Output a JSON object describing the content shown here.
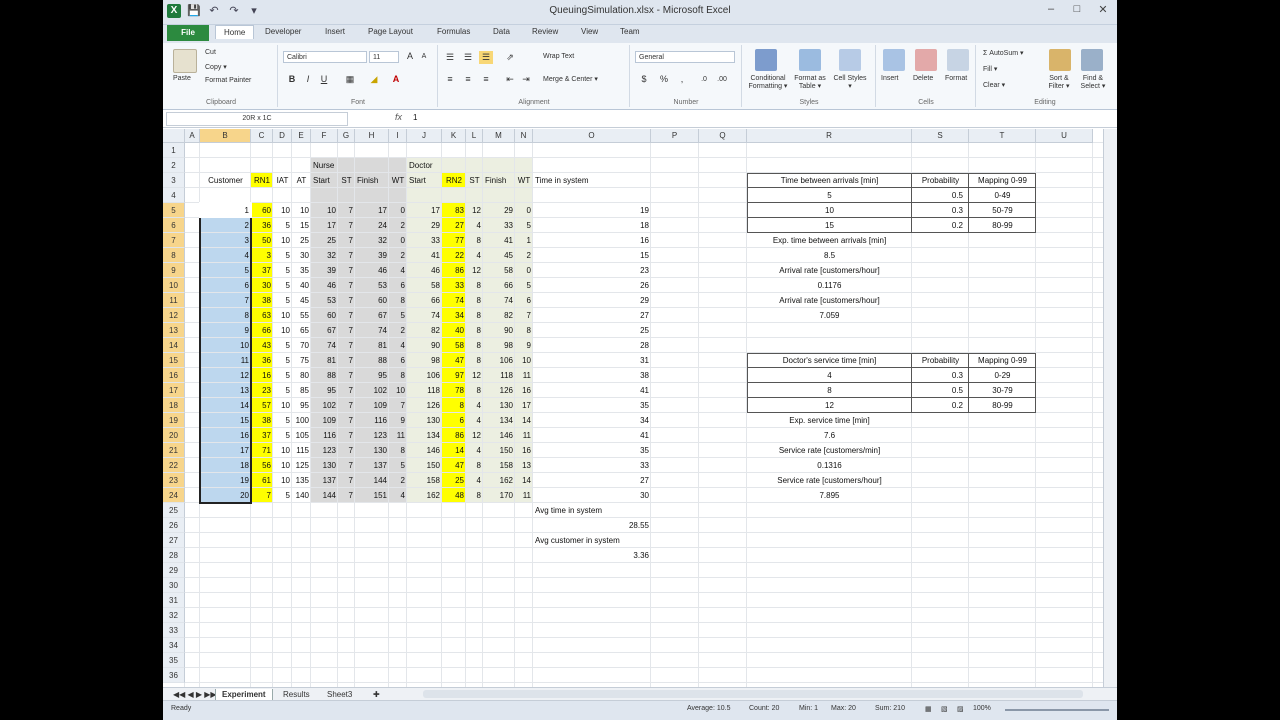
{
  "window": {
    "title": "QueuingSimulation.xlsx - Microsoft Excel",
    "controls": [
      "–",
      "□",
      "✕"
    ]
  },
  "qat": [
    "💾",
    "↶",
    "↷",
    "▾"
  ],
  "tabs": [
    "File",
    "Home",
    "Developer",
    "Insert",
    "Page Layout",
    "Formulas",
    "Data",
    "Review",
    "View",
    "Team"
  ],
  "ribbon": {
    "clipboard": {
      "label": "Clipboard",
      "paste": "Paste",
      "cut": "Cut",
      "copy": "Copy ▾",
      "format_painter": "Format Painter"
    },
    "font": {
      "label": "Font",
      "name": "Calibri",
      "size": "11",
      "bold": "B",
      "italic": "I",
      "underline": "U"
    },
    "alignment": {
      "label": "Alignment",
      "wrap": "Wrap Text",
      "merge": "Merge & Center ▾"
    },
    "number": {
      "label": "Number",
      "format": "General",
      "currency": "$",
      "percent": "%",
      "comma": ","
    },
    "styles": {
      "label": "Styles",
      "conditional": "Conditional Formatting ▾",
      "table": "Format as Table ▾",
      "cell": "Cell Styles ▾"
    },
    "cells": {
      "label": "Cells",
      "insert": "Insert",
      "delete": "Delete",
      "format": "Format"
    },
    "editing": {
      "label": "Editing",
      "autosum": "AutoSum ▾",
      "fill": "Fill ▾",
      "clear": "Clear ▾",
      "sort": "Sort & Filter ▾",
      "find": "Find & Select ▾"
    }
  },
  "formula_bar": {
    "name_box": "20R x 1C",
    "fx": "fx",
    "value": "1"
  },
  "columns": [
    "A",
    "B",
    "C",
    "D",
    "E",
    "F",
    "G",
    "H",
    "I",
    "J",
    "K",
    "L",
    "M",
    "N",
    "O",
    "P",
    "Q",
    "R",
    "S",
    "T",
    "U"
  ],
  "rows": [
    "1",
    "2",
    "3",
    "4",
    "5",
    "6",
    "7",
    "8",
    "9",
    "10",
    "11",
    "12",
    "13",
    "14",
    "15",
    "16",
    "17",
    "18",
    "19",
    "20",
    "21",
    "22",
    "23",
    "24",
    "25",
    "26",
    "27",
    "28",
    "29",
    "30",
    "31",
    "32",
    "33",
    "34",
    "35",
    "36"
  ],
  "headers": {
    "nurse": "Nurse",
    "doctor": "Doctor",
    "customer": "Customer",
    "rn1": "RN1",
    "iat": "IAT",
    "at": "AT",
    "start1": "Start",
    "st1": "ST",
    "finish1": "Finish",
    "wt1": "WT",
    "start2": "Start",
    "rn2": "RN2",
    "st2": "ST",
    "finish2": "Finish",
    "wt2": "WT",
    "tis": "Time in system"
  },
  "data_rows": [
    [
      "1",
      "60",
      "10",
      "10",
      "10",
      "7",
      "17",
      "0",
      "17",
      "83",
      "12",
      "29",
      "0",
      "19"
    ],
    [
      "2",
      "36",
      "5",
      "15",
      "17",
      "7",
      "24",
      "2",
      "29",
      "27",
      "4",
      "33",
      "5",
      "18"
    ],
    [
      "3",
      "50",
      "10",
      "25",
      "25",
      "7",
      "32",
      "0",
      "33",
      "77",
      "8",
      "41",
      "1",
      "16"
    ],
    [
      "4",
      "3",
      "5",
      "30",
      "32",
      "7",
      "39",
      "2",
      "41",
      "22",
      "4",
      "45",
      "2",
      "15"
    ],
    [
      "5",
      "37",
      "5",
      "35",
      "39",
      "7",
      "46",
      "4",
      "46",
      "86",
      "12",
      "58",
      "0",
      "23"
    ],
    [
      "6",
      "30",
      "5",
      "40",
      "46",
      "7",
      "53",
      "6",
      "58",
      "33",
      "8",
      "66",
      "5",
      "26"
    ],
    [
      "7",
      "38",
      "5",
      "45",
      "53",
      "7",
      "60",
      "8",
      "66",
      "74",
      "8",
      "74",
      "6",
      "29"
    ],
    [
      "8",
      "63",
      "10",
      "55",
      "60",
      "7",
      "67",
      "5",
      "74",
      "34",
      "8",
      "82",
      "7",
      "27"
    ],
    [
      "9",
      "66",
      "10",
      "65",
      "67",
      "7",
      "74",
      "2",
      "82",
      "40",
      "8",
      "90",
      "8",
      "25"
    ],
    [
      "10",
      "43",
      "5",
      "70",
      "74",
      "7",
      "81",
      "4",
      "90",
      "58",
      "8",
      "98",
      "9",
      "28"
    ],
    [
      "11",
      "36",
      "5",
      "75",
      "81",
      "7",
      "88",
      "6",
      "98",
      "47",
      "8",
      "106",
      "10",
      "31"
    ],
    [
      "12",
      "16",
      "5",
      "80",
      "88",
      "7",
      "95",
      "8",
      "106",
      "97",
      "12",
      "118",
      "11",
      "38"
    ],
    [
      "13",
      "23",
      "5",
      "85",
      "95",
      "7",
      "102",
      "10",
      "118",
      "78",
      "8",
      "126",
      "16",
      "41"
    ],
    [
      "14",
      "57",
      "10",
      "95",
      "102",
      "7",
      "109",
      "7",
      "126",
      "8",
      "4",
      "130",
      "17",
      "35"
    ],
    [
      "15",
      "38",
      "5",
      "100",
      "109",
      "7",
      "116",
      "9",
      "130",
      "6",
      "4",
      "134",
      "14",
      "34"
    ],
    [
      "16",
      "37",
      "5",
      "105",
      "116",
      "7",
      "123",
      "11",
      "134",
      "86",
      "12",
      "146",
      "11",
      "41"
    ],
    [
      "17",
      "71",
      "10",
      "115",
      "123",
      "7",
      "130",
      "8",
      "146",
      "14",
      "4",
      "150",
      "16",
      "35"
    ],
    [
      "18",
      "56",
      "10",
      "125",
      "130",
      "7",
      "137",
      "5",
      "150",
      "47",
      "8",
      "158",
      "13",
      "33"
    ],
    [
      "19",
      "61",
      "10",
      "135",
      "137",
      "7",
      "144",
      "2",
      "158",
      "25",
      "4",
      "162",
      "14",
      "27"
    ],
    [
      "20",
      "7",
      "5",
      "140",
      "144",
      "7",
      "151",
      "4",
      "162",
      "48",
      "8",
      "170",
      "11",
      "30"
    ]
  ],
  "summary": {
    "avg_time_label": "Avg time in system",
    "avg_time_value": "28.55",
    "avg_cust_label": "Avg customer in system",
    "avg_cust_value": "3.36"
  },
  "arrival_table": {
    "headers": [
      "Time between arrivals [min]",
      "Probability",
      "Mapping 0-99"
    ],
    "rows": [
      [
        "5",
        "0.5",
        "0-49"
      ],
      [
        "10",
        "0.3",
        "50-79"
      ],
      [
        "15",
        "0.2",
        "80-99"
      ]
    ]
  },
  "arrival_stats": {
    "exp_label": "Exp. time between arrivals [min]",
    "exp_value": "8.5",
    "rate_min_label": "Arrival rate [customers/hour]",
    "rate_min_value": "0.1176",
    "rate_hr_label": "Arrival rate [customers/hour]",
    "rate_hr_value": "7.059"
  },
  "service_table": {
    "headers": [
      "Doctor's service time [min]",
      "Probability",
      "Mapping 0-99"
    ],
    "rows": [
      [
        "4",
        "0.3",
        "0-29"
      ],
      [
        "8",
        "0.5",
        "30-79"
      ],
      [
        "12",
        "0.2",
        "80-99"
      ]
    ]
  },
  "service_stats": {
    "exp_label": "Exp. service time [min]",
    "exp_value": "7.6",
    "rate_min_label": "Service rate [customers/min]",
    "rate_min_value": "0.1316",
    "rate_hr_label": "Service rate [customers/hour]",
    "rate_hr_value": "7.895"
  },
  "sheets": [
    "Experiment",
    "Results",
    "Sheet3"
  ],
  "status": {
    "ready": "Ready",
    "average": "Average: 10.5",
    "count": "Count: 20",
    "min": "Min: 1",
    "max": "Max: 20",
    "sum": "Sum: 210",
    "zoom": "100%"
  },
  "colors": {
    "yellow": "#ffff00",
    "gray": "#d9d9d9",
    "selection": "#bdd7ee",
    "header_sel": "#f7d58b"
  }
}
